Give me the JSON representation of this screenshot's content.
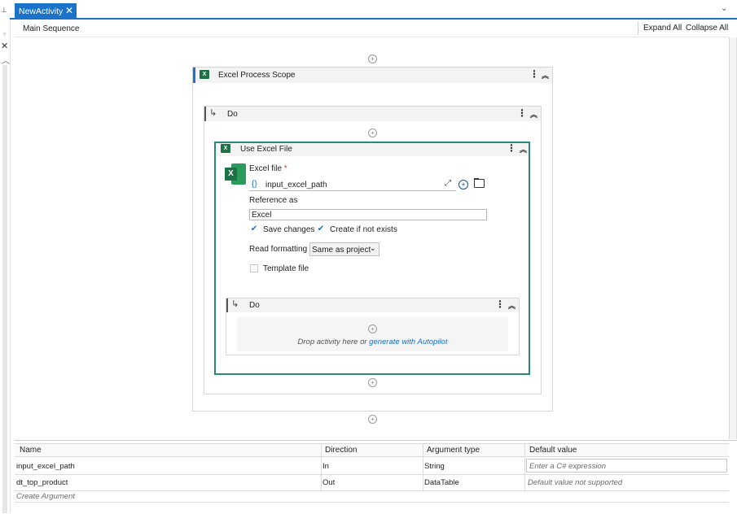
{
  "tab": {
    "title": "NewActivity",
    "close": "✕"
  },
  "toolbar": {
    "breadcrumb": "Main Sequence",
    "expand_all": "Expand All",
    "collapse_all": "Collapse All"
  },
  "workflow": {
    "scope_title": "Excel Process Scope",
    "do_label": "Do",
    "use_excel_title": "Use Excel File",
    "excel_file_label": "Excel file",
    "required_mark": "*",
    "excel_file_value": "input_excel_path",
    "expr_icon": "{}",
    "reference_label": "Reference as",
    "reference_value": "Excel",
    "save_changes": "Save changes",
    "create_if_not_exists": "Create if not exists",
    "read_formatting_label": "Read formatting",
    "read_formatting_value": "Same as project",
    "template_file": "Template file",
    "inner_do_label": "Do",
    "drop_text": "Drop activity here or",
    "autopilot_link": "generate with Autopilot"
  },
  "arguments": {
    "headers": [
      "Name",
      "Direction",
      "Argument type",
      "Default value"
    ],
    "rows": [
      {
        "name": "input_excel_path",
        "direction": "In",
        "type": "String",
        "default": "Enter a C# expression"
      },
      {
        "name": "dt_top_product",
        "direction": "Out",
        "type": "DataTable",
        "default": "Default value not supported"
      }
    ],
    "create": "Create Argument"
  },
  "colors": {
    "accent": "#1a73c9",
    "excel_green": "#1e7145",
    "teal_border": "#2a8a7a"
  },
  "icons": [
    "pin-icon",
    "close-icon",
    "chevron-up-icon",
    "excel-icon",
    "add-icon",
    "kebab-menu-icon",
    "collapse-icon",
    "do-arrow-icon",
    "folder-icon",
    "checkmark-icon",
    "dropdown-chevron-icon",
    "expand-icon"
  ]
}
